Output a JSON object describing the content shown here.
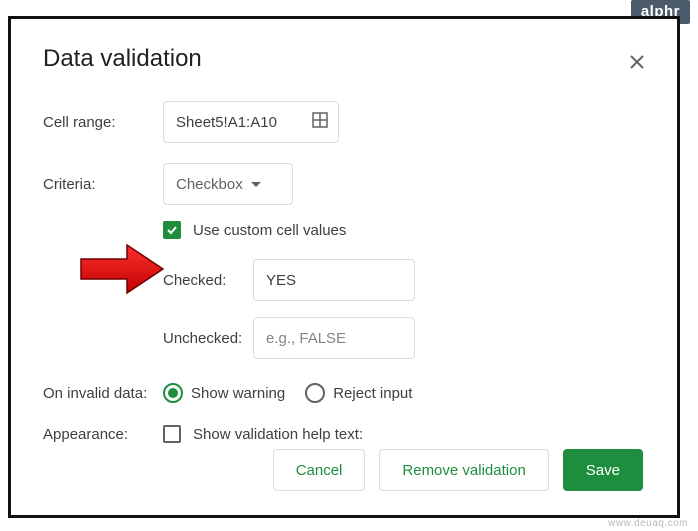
{
  "badge": "alphr",
  "watermark": "www.deuaq.com",
  "dialog": {
    "title": "Data validation",
    "cell_range_label": "Cell range:",
    "cell_range_value": "Sheet5!A1:A10",
    "criteria_label": "Criteria:",
    "criteria_value": "Checkbox",
    "use_custom_label": "Use custom cell values",
    "use_custom_checked": true,
    "checked_label": "Checked:",
    "checked_value": "YES",
    "unchecked_label": "Unchecked:",
    "unchecked_placeholder": "e.g., FALSE",
    "on_invalid_label": "On invalid data:",
    "invalid_option_warning": "Show warning",
    "invalid_option_reject": "Reject input",
    "invalid_selected": "warning",
    "appearance_label": "Appearance:",
    "appearance_checkbox_label": "Show validation help text:",
    "appearance_checked": false,
    "buttons": {
      "cancel": "Cancel",
      "remove": "Remove validation",
      "save": "Save"
    }
  }
}
